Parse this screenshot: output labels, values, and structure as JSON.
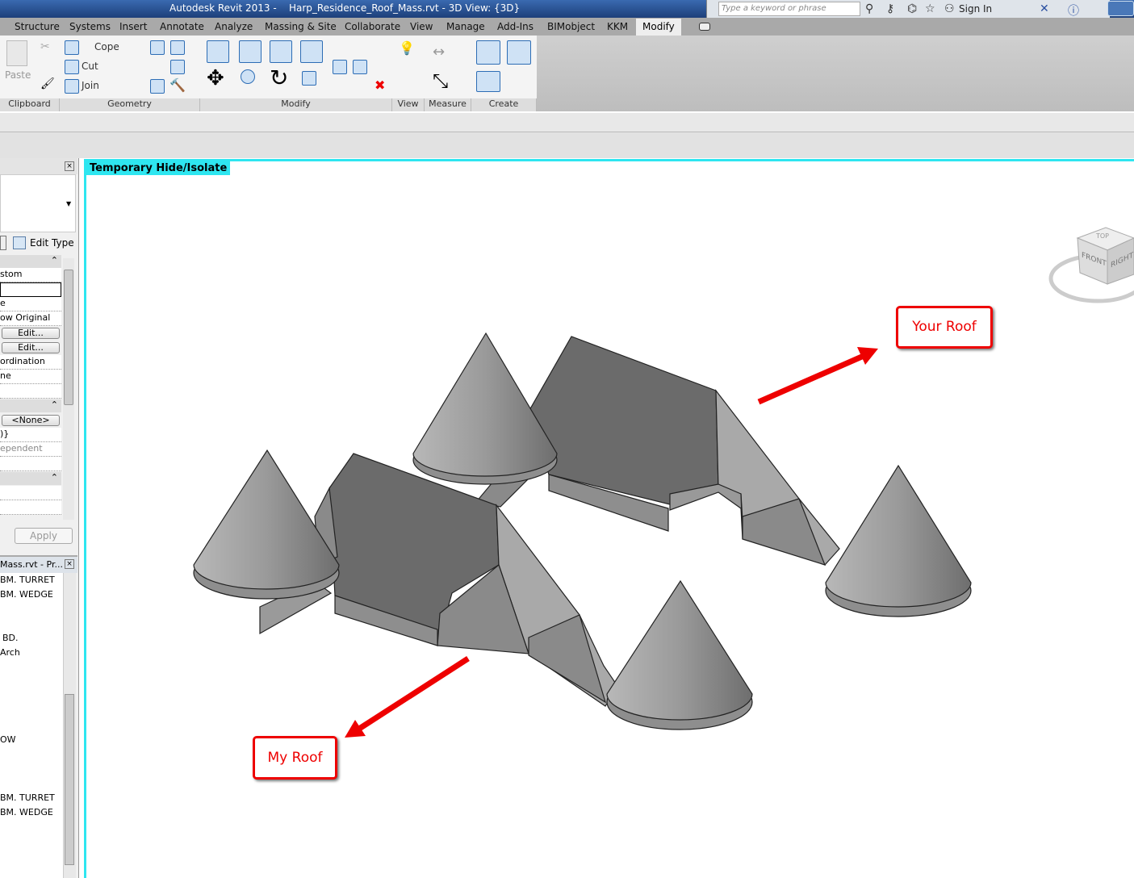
{
  "title": "Autodesk Revit 2013 -    Harp_Residence_Roof_Mass.rvt - 3D View: {3D}",
  "search_placeholder": "Type a keyword or phrase",
  "sign_in": "Sign In",
  "tabs": [
    "Structure",
    "Systems",
    "Insert",
    "Annotate",
    "Analyze",
    "Massing & Site",
    "Collaborate",
    "View",
    "Manage",
    "Add-Ins",
    "BIMobject",
    "KKM",
    "Modify"
  ],
  "ribbon": {
    "panels": [
      "Clipboard",
      "Geometry",
      "Modify",
      "View",
      "Measure",
      "Create"
    ],
    "paste": "Paste",
    "cope": "Cope",
    "cut": "Cut",
    "join": "Join"
  },
  "properties": {
    "edit_type": "Edit Type",
    "rows": [
      "stom",
      "",
      "e",
      "ow Original",
      "Edit...",
      "Edit...",
      "ordination",
      "ne",
      ""
    ],
    "rows2": [
      "<None>",
      ")}",
      "ependent"
    ],
    "apply": "Apply"
  },
  "browser": {
    "title": "Mass.rvt - Pr...",
    "items": [
      "BM. TURRET",
      "BM. WEDGE",
      "BD.",
      "Arch",
      "OW",
      "BM. TURRET",
      "BM. WEDGE"
    ]
  },
  "viewport": {
    "hide_isolate": "Temporary Hide/Isolate",
    "callout_your": "Your Roof",
    "callout_my": "My Roof",
    "viewcube": {
      "top": "TOP",
      "front": "FRONT",
      "right": "RIGHT"
    }
  },
  "colors": {
    "accent_cyan": "#2ee6f0",
    "callout_red": "#e00000"
  }
}
